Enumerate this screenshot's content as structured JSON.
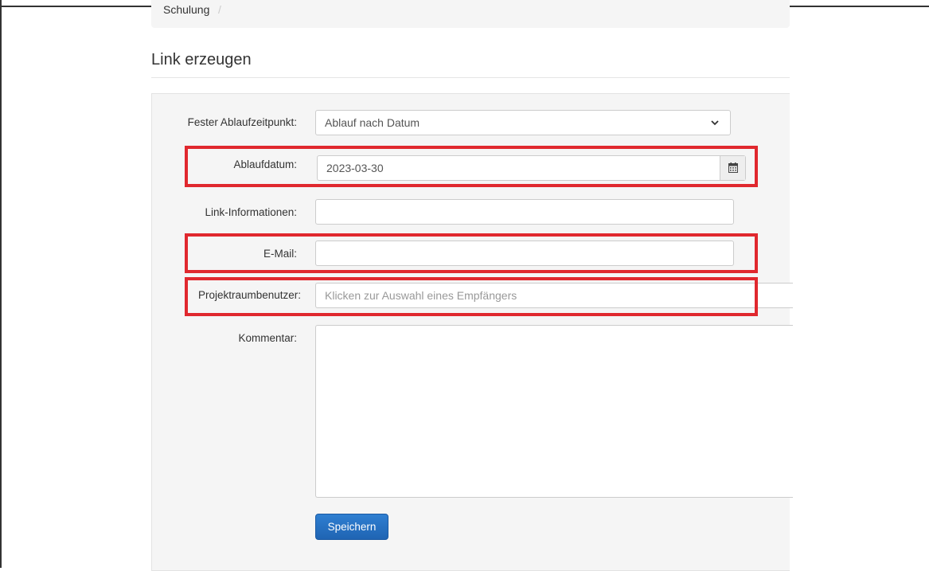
{
  "breadcrumb": {
    "item": "Schulung",
    "separator": "/"
  },
  "page": {
    "title": "Link erzeugen"
  },
  "form": {
    "expiry_mode": {
      "label": "Fester Ablaufzeitpunkt:",
      "value": "Ablauf nach Datum"
    },
    "expiry_date": {
      "label": "Ablaufdatum:",
      "value": "2023-03-30",
      "icon": "calendar-icon"
    },
    "link_info": {
      "label": "Link-Informationen:",
      "value": ""
    },
    "email": {
      "label": "E-Mail:",
      "value": ""
    },
    "project_user": {
      "label": "Projektraumbenutzer:",
      "placeholder": "Klicken zur Auswahl eines Empfängers"
    },
    "comment": {
      "label": "Kommentar:",
      "value": ""
    },
    "save_label": "Speichern"
  },
  "colors": {
    "highlight": "#e0282e",
    "primary_button": "#1f64b3",
    "well_bg": "#f5f5f5"
  }
}
